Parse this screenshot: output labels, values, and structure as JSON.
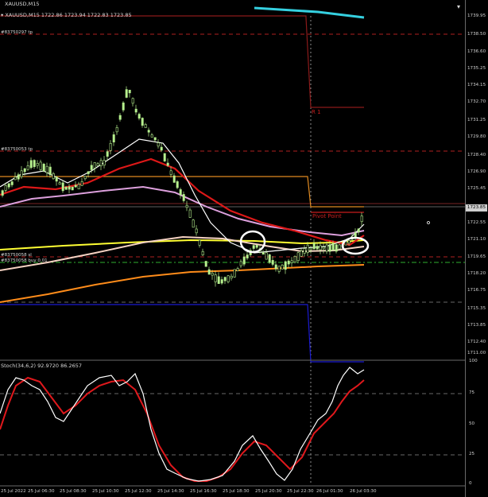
{
  "chart": {
    "symbol_line": "XAUUSD,M15  1722.86 1723.94 1722.83 1723.85",
    "title_tab": "XAUUSD,M15",
    "current_price": "1723.85",
    "order_tags": {
      "tp_top": "#83750297 tp",
      "tp_mid": "#83750053 tp",
      "sl": "#83750058 sl",
      "buy": "#83750058 buy 0.01"
    },
    "levels": {
      "r1": "R 1",
      "pivot": "Pivot Point"
    },
    "price_axis": [
      "1739.95",
      "1738.50",
      "1736.60",
      "1735.25",
      "1734.15",
      "1732.70",
      "1731.25",
      "1729.80",
      "1728.40",
      "1726.90",
      "1725.45",
      "1723.85",
      "1722.55",
      "1721.10",
      "1719.65",
      "1718.20",
      "1716.75",
      "1715.35",
      "1713.85",
      "1712.40",
      "1711.00"
    ],
    "stoch_label": "Stoch(34,6,2) 92.9720 86.2657",
    "stoch_axis": [
      "100",
      "75",
      "50",
      "25",
      "0"
    ],
    "time_axis": [
      "25 Jul 2022",
      "25 Jul 06:30",
      "25 Jul 08:30",
      "25 Jul 10:30",
      "25 Jul 12:30",
      "25 Jul 14:30",
      "25 Jul 16:30",
      "25 Jul 18:30",
      "25 Jul 20:30",
      "25 Jul 22:30",
      "26 Jul 01:30",
      "26 Jul 03:30"
    ],
    "colors": {
      "bull_candle": "#b6f08e",
      "ema_slow": "#ff8c1a",
      "ema_yellow": "#ffff33",
      "ema_red": "#dd1818",
      "ema_violet": "#dda0dd",
      "ema_white": "#ffffff",
      "ema_peach": "#f5d2c2",
      "r1_line": "#8b1a1a",
      "pivot_line": "#c81e1e",
      "cyan": "#35d0e0",
      "navy": "#1a1ad0",
      "stoch_main": "#ffffff",
      "stoch_signal": "#e0181c"
    }
  }
}
